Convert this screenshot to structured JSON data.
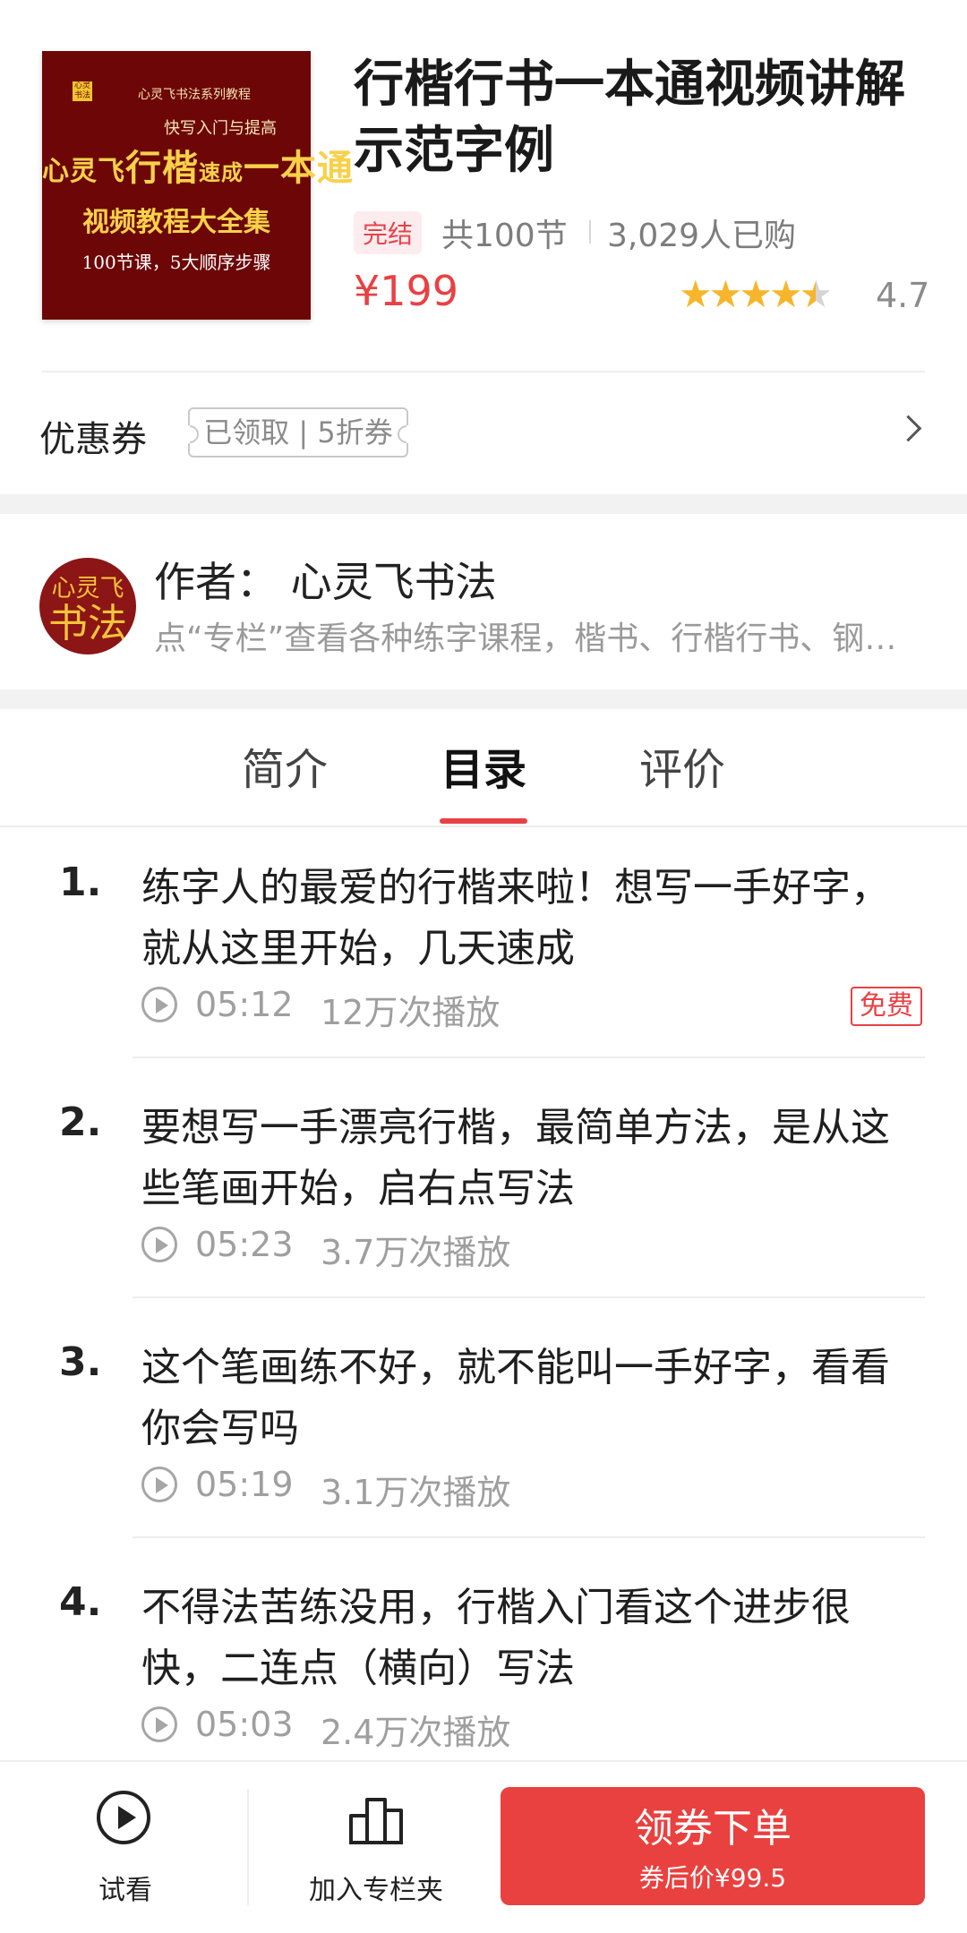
{
  "cover": {
    "series_text": "心灵飞书法系列教程",
    "seal_text": "心灵书法",
    "subtitle": "快写入门与提高",
    "main_left": "心灵飞",
    "main_mid": "行楷",
    "main_small": "速成",
    "main_right": "一本通",
    "line3": "视频教程大全集",
    "line4": "100节课，5大顺序步骤"
  },
  "course": {
    "title": "行楷行书一本通视频讲解示范字例",
    "status": "完结",
    "lesson_count": "共100节",
    "buyers": "3,029人已购",
    "price": "¥199",
    "rating": "4.7",
    "stars": "4.5 / 5"
  },
  "coupon": {
    "label": "优惠券",
    "tag": "已领取 | 5折券"
  },
  "author": {
    "avatar_line1": "心灵飞",
    "avatar_line2": "书法",
    "name": "作者：  心灵飞书法",
    "desc": "点“专栏”查看各种练字课程，楷书、行楷行书、钢笔字…"
  },
  "tabs": [
    {
      "label": "简介",
      "active": false
    },
    {
      "label": "目录",
      "active": true
    },
    {
      "label": "评价",
      "active": false
    }
  ],
  "lessons": [
    {
      "num": "1.",
      "title": "练字人的最爱的行楷来啦！想写一手好字，就从这里开始，几天速成",
      "duration": "05:12",
      "plays": "12万次播放",
      "badge": "免费"
    },
    {
      "num": "2.",
      "title": "要想写一手漂亮行楷，最简单方法，是从这些笔画开始，启右点写法",
      "duration": "05:23",
      "plays": "3.7万次播放"
    },
    {
      "num": "3.",
      "title": "这个笔画练不好，就不能叫一手好字，看看你会写吗",
      "duration": "05:19",
      "plays": "3.1万次播放"
    },
    {
      "num": "4.",
      "title": "不得法苦练没用，行楷入门看这个进步很快，二连点（横向）写法",
      "duration": "05:03",
      "plays": "2.4万次播放"
    }
  ],
  "bottom": {
    "trial_label": "试看",
    "favorite_label": "加入专栏夹",
    "order_label": "领券下单",
    "order_sub": "券后价¥99.5"
  },
  "colors": {
    "accent": "#e84144",
    "star": "#f7b52c",
    "cover_bg": "#6d0707"
  }
}
